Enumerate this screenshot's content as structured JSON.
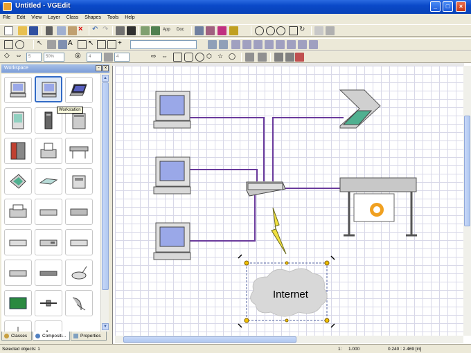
{
  "window": {
    "title": "Untitled - VGEdit"
  },
  "menu": [
    "File",
    "Edit",
    "View",
    "Layer",
    "Class",
    "Shapes",
    "Tools",
    "Help"
  ],
  "toolbar": {
    "app_label": "App",
    "doc_label": "Doc",
    "combo1": "5",
    "combo2": "50%",
    "combo3": "4",
    "combo4": "4"
  },
  "workspace": {
    "title": "Workspace",
    "tooltip": "Workstation",
    "tabs": [
      {
        "label": "Classes"
      },
      {
        "label": "Compositi..."
      },
      {
        "label": "Properties"
      }
    ]
  },
  "diagram": {
    "cloud_label": "Internet"
  },
  "status": {
    "text": "Selected objects: 1",
    "page": "1:",
    "zoom": "1.000",
    "coords": "0.240 : 2.469 [in]"
  },
  "colors": {
    "link": "#6a3a9c",
    "selection": "#316ac5",
    "titlebar": "#0a49c8"
  }
}
